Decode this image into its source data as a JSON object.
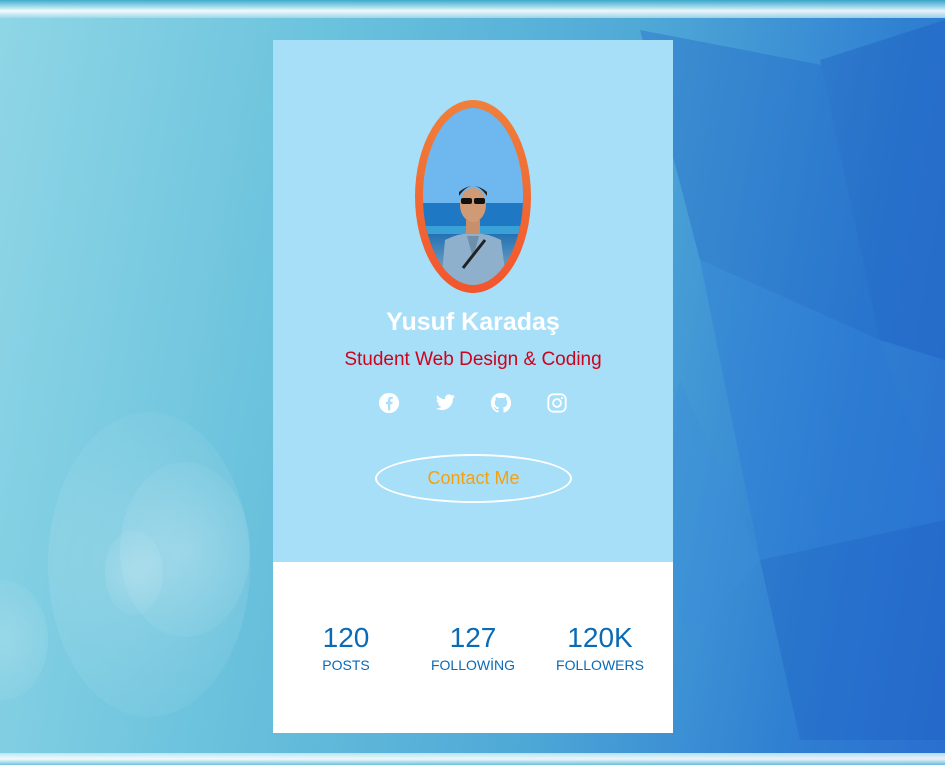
{
  "profile": {
    "name": "Yusuf Karadaş",
    "title": "Student Web Design & Coding",
    "contact_label": "Contact Me"
  },
  "social": [
    {
      "icon": "facebook-icon"
    },
    {
      "icon": "twitter-icon"
    },
    {
      "icon": "github-icon"
    },
    {
      "icon": "instagram-icon"
    }
  ],
  "stats": [
    {
      "value": "120",
      "label": "POSTS"
    },
    {
      "value": "127",
      "label": "FOLLOWİNG"
    },
    {
      "value": "120K",
      "label": "FOLLOWERS"
    }
  ],
  "colors": {
    "card_top": "#a7dff9",
    "card_bottom": "#ffffff",
    "name": "#ffffff",
    "title": "#d0021b",
    "contact_text": "#f5a00f",
    "stats_text": "#0a6ab6",
    "avatar_ring": "#f2552e"
  }
}
